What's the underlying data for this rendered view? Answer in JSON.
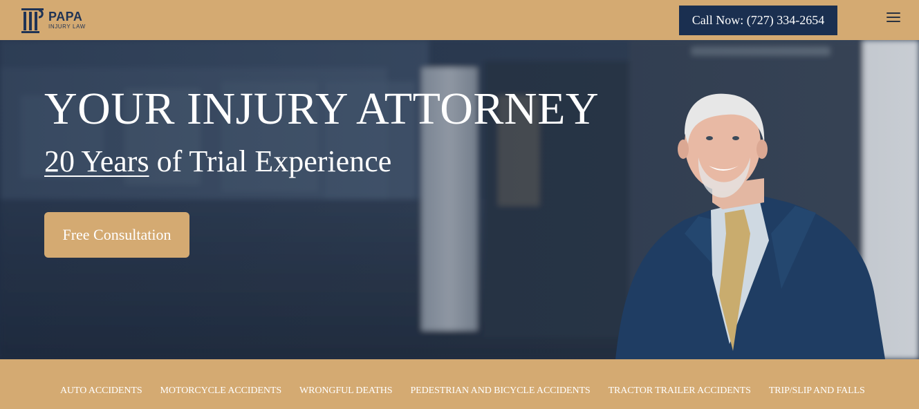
{
  "header": {
    "logo_name": "PAPA",
    "logo_sub": "INJURY LAW",
    "call_label": "Call Now: (727) 334-2654",
    "menu_icon": "hamburger-menu-icon"
  },
  "hero": {
    "title": "YOUR INJURY ATTORNEY",
    "subtitle_underlined": "20 Years",
    "subtitle_rest": " of Trial Experience",
    "cta_label": "Free Consultation"
  },
  "practice_areas": [
    "AUTO ACCIDENTS",
    "MOTORCYCLE ACCIDENTS",
    "WRONGFUL DEATHS",
    "PEDESTRIAN AND BICYCLE ACCIDENTS",
    "TRACTOR TRAILER ACCIDENTS",
    "TRIP/SLIP AND FALLS"
  ],
  "colors": {
    "gold": "#d4aa72",
    "navy": "#1a2f50",
    "logo_navy": "#1f3355"
  }
}
